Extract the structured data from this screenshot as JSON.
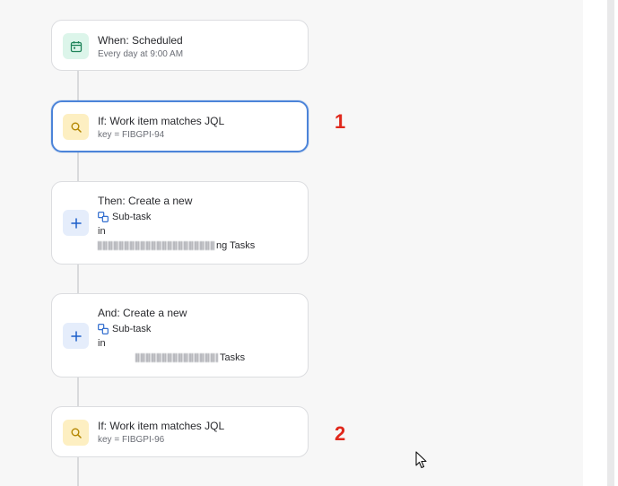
{
  "colors": {
    "selected_border": "#4c84d9",
    "marker_red": "#e0281c",
    "trigger_icon_bg": "#dcf5ea",
    "condition_icon_bg": "#fdefc2",
    "action_icon_bg": "#e5edfb"
  },
  "flow": {
    "trigger": {
      "icon": "calendar-icon",
      "title": "When: Scheduled",
      "subtitle": "Every day at 9:00 AM"
    },
    "condition_1": {
      "icon": "search-icon",
      "title": "If: Work item matches JQL",
      "subtitle": "key = FIBGPI-94",
      "marker": "1"
    },
    "action_1": {
      "icon": "plus-icon",
      "title": "Then: Create a new",
      "issue_type": "Sub-task",
      "in_label": "in",
      "project_visible_suffix": "ng Tasks"
    },
    "action_2": {
      "icon": "plus-icon",
      "title": "And: Create a new",
      "issue_type": "Sub-task",
      "in_label": "in",
      "project_visible_suffix": "Tasks"
    },
    "condition_2": {
      "icon": "search-icon",
      "title": "If: Work item matches JQL",
      "subtitle": "key = FIBGPI-96",
      "marker": "2"
    }
  }
}
